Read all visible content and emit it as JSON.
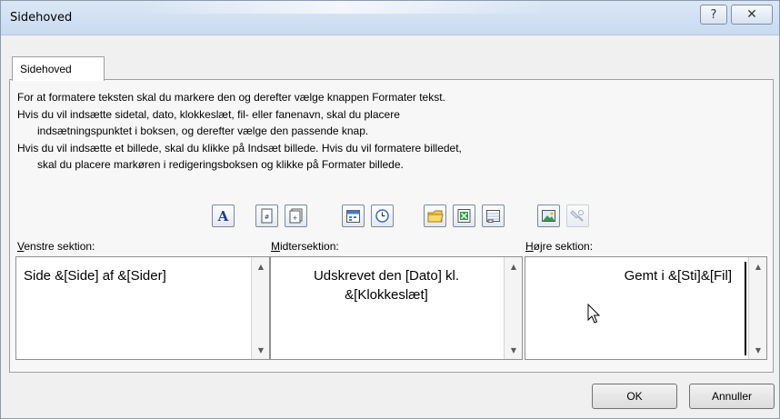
{
  "window": {
    "title": "Sidehoved",
    "help_glyph": "?",
    "close_glyph": "✕"
  },
  "tab": {
    "label": "Sidehoved"
  },
  "instructions": {
    "line1": "For at formatere teksten skal du markere den og derefter vælge knappen Formater tekst.",
    "line2": "Hvis du vil indsætte sidetal, dato, klokkeslæt, fil- eller fanenavn, skal du placere",
    "line3": "indsætningspunktet i boksen, og derefter vælge den passende knap.",
    "line4": "Hvis du vil indsætte et billede, skal du klikke på Indsæt billede. Hvis du vil formatere billedet,",
    "line5": "skal du placere markøren i redigeringsboksen og klikke på Formater billede."
  },
  "toolbar": {
    "buttons": [
      {
        "icon": "format-text-icon",
        "glyph": "A"
      },
      {
        "icon": "page-number-icon"
      },
      {
        "icon": "number-of-pages-icon"
      },
      {
        "icon": "date-icon"
      },
      {
        "icon": "time-icon"
      },
      {
        "icon": "file-path-icon"
      },
      {
        "icon": "file-name-icon"
      },
      {
        "icon": "sheet-name-icon"
      },
      {
        "icon": "insert-picture-icon"
      },
      {
        "icon": "format-picture-icon",
        "disabled": true
      }
    ]
  },
  "sections": {
    "left": {
      "label_hotkey": "V",
      "label_rest": "enstre sektion:",
      "value": "Side &[Side] af &[Sider]"
    },
    "center": {
      "label_hotkey": "M",
      "label_rest": "idtersektion:",
      "value": "Udskrevet den [Dato] kl.\n&[Klokkeslæt]"
    },
    "right": {
      "label_hotkey": "H",
      "label_rest": "øjre sektion:",
      "value": "Gemt i &[Sti]&[Fil]"
    }
  },
  "footer": {
    "ok_label": "OK",
    "cancel_label": "Annuller"
  },
  "colors": {
    "title_bar": "#c9daf0",
    "dialog_bg": "#f0f0f0",
    "tab_panel_bg": "#f7f7f7"
  }
}
